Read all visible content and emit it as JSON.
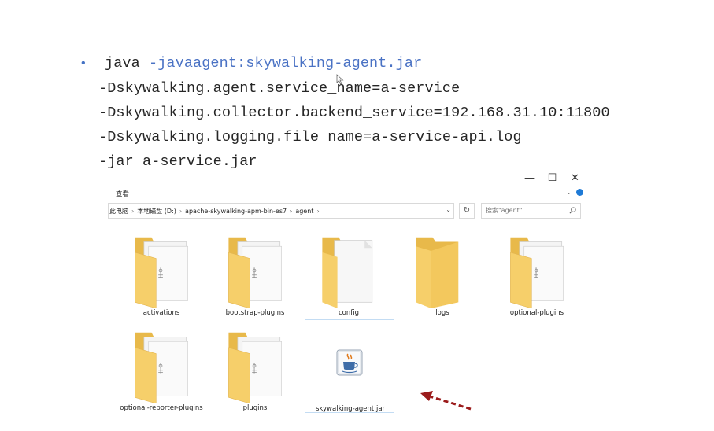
{
  "slide": {
    "line1_prefix": "java ",
    "line1_highlight": "-javaagent:skywalking-agent.jar",
    "line2": "-Dskywalking.agent.service_name=a-service",
    "line3": "-Dskywalking.collector.backend_service=192.168.31.10:11800",
    "line4": "-Dskywalking.logging.file_name=a-service-api.log",
    "line5": "-jar a-service.jar",
    "bullet": "•",
    "accent_color": "#4a72c4"
  },
  "explorer": {
    "window_controls": {
      "minimize": "—",
      "maximize": "☐",
      "close": "✕"
    },
    "ribbon_tab": "查看",
    "address_crumbs": [
      "此电脑",
      "本地磁盘 (D:)",
      "apache-skywalking-apm-bin-es7",
      "agent"
    ],
    "crumb_separator": "›",
    "search_placeholder": "搜索\"agent\"",
    "items": [
      {
        "label": "activations",
        "icon": "folder-with-files-icon"
      },
      {
        "label": "bootstrap-plugins",
        "icon": "folder-with-files-icon"
      },
      {
        "label": "config",
        "icon": "folder-with-document-icon"
      },
      {
        "label": "logs",
        "icon": "empty-folder-icon"
      },
      {
        "label": "optional-plugins",
        "icon": "folder-with-files-icon"
      },
      {
        "label": "optional-reporter-plugins",
        "icon": "folder-with-files-icon"
      },
      {
        "label": "plugins",
        "icon": "folder-with-files-icon"
      },
      {
        "label": "skywalking-agent.jar",
        "icon": "java-jar-icon"
      }
    ],
    "selected_item": "skywalking-agent.jar"
  },
  "annotation": {
    "arrow_icon": "red-dashed-arrow-icon",
    "arrow_color": "#9b1b1b"
  }
}
